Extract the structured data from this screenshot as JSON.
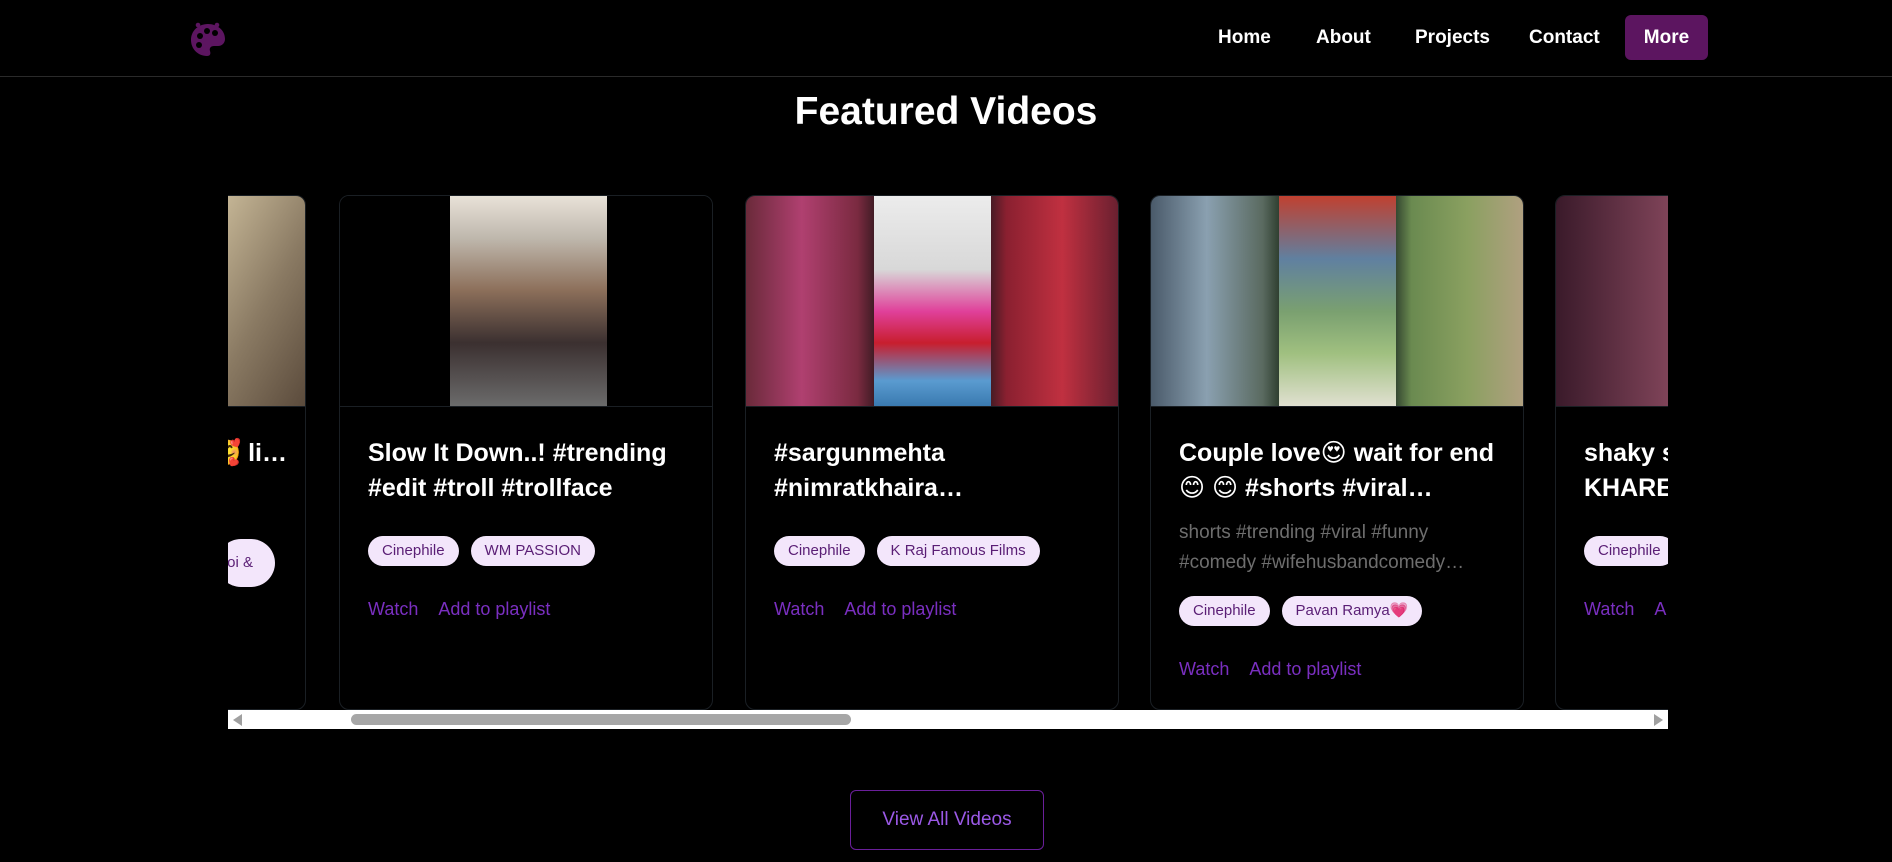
{
  "nav": {
    "links": [
      "Home",
      "About",
      "Projects",
      "Contact"
    ],
    "more_label": "More"
  },
  "section_title": "Featured Videos",
  "cards": [
    {
      "title": "🥰 li…",
      "tags": [
        "oi &"
      ],
      "actions": []
    },
    {
      "title": "Slow It Down..! #trending #edit #troll #trollface",
      "desc": "",
      "tags": [
        "Cinephile",
        "WM PASSION"
      ],
      "actions": [
        "Watch",
        "Add to playlist"
      ]
    },
    {
      "title": "#sargunmehta #nimratkhaira…",
      "desc": "",
      "tags": [
        "Cinephile",
        "K Raj Famous Films"
      ],
      "actions": [
        "Watch",
        "Add to playlist"
      ]
    },
    {
      "title": "Couple love😍 wait for end😊 😊 #shorts #viral…",
      "desc": "shorts #trending #viral #funny #comedy #wifehusbandcomedy…",
      "tags": [
        "Cinephile",
        "Pavan Ramya💗"
      ],
      "actions": [
        "Watch",
        "Add to playlist"
      ]
    },
    {
      "title": "shaky s KHARE",
      "desc": "",
      "tags": [
        "Cinephile"
      ],
      "actions": [
        "Watch",
        "A"
      ]
    }
  ],
  "view_all_label": "View All Videos",
  "colors": {
    "accent": "#5c1560",
    "link": "#7a2fc0",
    "tag_bg": "#f3e6fb"
  }
}
